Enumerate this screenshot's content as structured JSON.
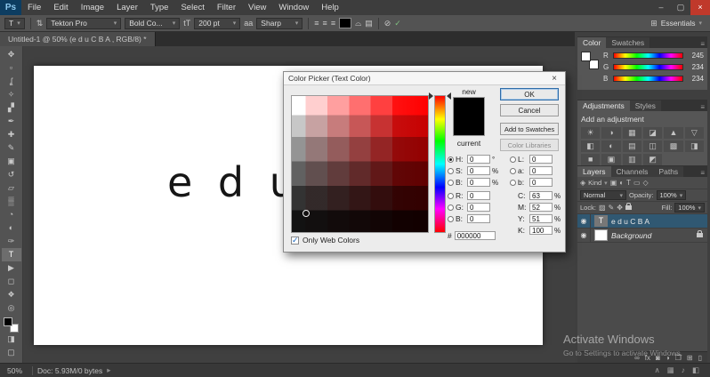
{
  "ui": {
    "caret": "▾",
    "check": "✓",
    "accent_blue": "#0d3d61",
    "selected_layer_blue": "#305872"
  },
  "window": {
    "minimize": "–",
    "maximize": "▢",
    "close": "×"
  },
  "menu": {
    "logo": "Ps",
    "items": [
      "File",
      "Edit",
      "Image",
      "Layer",
      "Type",
      "Select",
      "Filter",
      "View",
      "Window",
      "Help"
    ]
  },
  "options": {
    "tool_preset": "T",
    "orientation_icon": "⇅",
    "font_family": "Tekton Pro",
    "font_style": "Bold Co...",
    "size_icon": "tT",
    "font_size": "200 pt",
    "aa_icon": "aa",
    "anti_alias": "Sharp",
    "align_left_icon": "≡",
    "align_center_icon": "≡",
    "align_right_icon": "≡",
    "text_color": "#000000",
    "warp_icon": "⌓",
    "panels_icon": "▤",
    "cancel_icon": "⊘",
    "commit_icon": "✓",
    "workspace_icon": "⊞",
    "workspace": "Essentials"
  },
  "tab": {
    "title": "Untitled-1 @ 50% (e d u C B A , RGB/8) *"
  },
  "tools": [
    {
      "name": "move",
      "glyph": "✥"
    },
    {
      "name": "marquee",
      "glyph": "▫"
    },
    {
      "name": "lasso",
      "glyph": "ʆ"
    },
    {
      "name": "quick-selection",
      "glyph": "✧"
    },
    {
      "name": "crop",
      "glyph": "▞"
    },
    {
      "name": "eyedropper",
      "glyph": "✒"
    },
    {
      "name": "healing-brush",
      "glyph": "✚"
    },
    {
      "name": "brush",
      "glyph": "✎"
    },
    {
      "name": "clone-stamp",
      "glyph": "▣"
    },
    {
      "name": "history-brush",
      "glyph": "↺"
    },
    {
      "name": "eraser",
      "glyph": "▱"
    },
    {
      "name": "gradient",
      "glyph": "▒"
    },
    {
      "name": "blur",
      "glyph": "◔"
    },
    {
      "name": "dodge",
      "glyph": "◐"
    },
    {
      "name": "pen",
      "glyph": "✑"
    },
    {
      "name": "type",
      "glyph": "T"
    },
    {
      "name": "path-selection",
      "glyph": "▶"
    },
    {
      "name": "shape",
      "glyph": "◻"
    },
    {
      "name": "hand",
      "glyph": "❖"
    },
    {
      "name": "zoom",
      "glyph": "◎"
    },
    {
      "name": "quick-mask",
      "glyph": "◨"
    },
    {
      "name": "screen-mode",
      "glyph": "▢"
    }
  ],
  "canvas": {
    "text": "e d u C B A"
  },
  "dialog": {
    "title": "Color Picker (Text Color)",
    "close": "×",
    "new_label": "new",
    "current_label": "current",
    "picked_color": "#000000",
    "ok": "OK",
    "cancel": "Cancel",
    "add_to_swatches": "Add to Swatches",
    "color_libraries": "Color Libraries",
    "hsb": [
      {
        "label": "H:",
        "value": "0",
        "unit": "°"
      },
      {
        "label": "S:",
        "value": "0",
        "unit": "%"
      },
      {
        "label": "B:",
        "value": "0",
        "unit": "%"
      }
    ],
    "rgb": [
      {
        "label": "R:",
        "value": "0",
        "unit": ""
      },
      {
        "label": "G:",
        "value": "0",
        "unit": ""
      },
      {
        "label": "B:",
        "value": "0",
        "unit": ""
      }
    ],
    "lab": [
      {
        "label": "L:",
        "value": "0",
        "unit": ""
      },
      {
        "label": "a:",
        "value": "0",
        "unit": ""
      },
      {
        "label": "b:",
        "value": "0",
        "unit": ""
      }
    ],
    "cmyk": [
      {
        "label": "C:",
        "value": "63",
        "unit": "%"
      },
      {
        "label": "M:",
        "value": "52",
        "unit": "%"
      },
      {
        "label": "Y:",
        "value": "51",
        "unit": "%"
      },
      {
        "label": "K:",
        "value": "100",
        "unit": "%"
      }
    ],
    "hex_label": "#",
    "hex_value": "000000",
    "only_web_colors": "Only Web Colors"
  },
  "color_panel": {
    "tabs": [
      "Color",
      "Swatches"
    ],
    "menu_icon": "≡",
    "sliders": [
      {
        "label": "R",
        "value": "245"
      },
      {
        "label": "G",
        "value": "234"
      },
      {
        "label": "B",
        "value": "234"
      }
    ]
  },
  "adjustments": {
    "tabs": [
      "Adjustments",
      "Styles"
    ],
    "menu_icon": "≡",
    "title": "Add an adjustment",
    "icons": [
      "☀",
      "◑",
      "▦",
      "◪",
      "▲",
      "▽",
      "◧",
      "◐",
      "▤",
      "◫",
      "▩",
      "◨",
      "■",
      "▣",
      "▥",
      "◩"
    ]
  },
  "layers": {
    "tabs": [
      "Layers",
      "Channels",
      "Paths"
    ],
    "menu_icon": "≡",
    "filter": {
      "search_icon": "◈",
      "kind": "Kind",
      "icons": [
        "▣",
        "◐",
        "T",
        "▭",
        "◇"
      ]
    },
    "blend_mode": "Normal",
    "opacity_label": "Opacity:",
    "opacity": "100%",
    "lock_label": "Lock:",
    "lock_icons": [
      "▨",
      "✎",
      "✥"
    ],
    "fill_label": "Fill:",
    "fill": "100%",
    "eye_icon": "◉",
    "rows": [
      {
        "thumb": "T",
        "name": "e d u C B A"
      },
      {
        "thumb": "",
        "name": "Background"
      }
    ],
    "bottom_icons": [
      "∞",
      "fx",
      "◙",
      "◑",
      "❐",
      "⊞",
      "▯"
    ]
  },
  "status": {
    "zoom": "50%",
    "doc_info": "Doc: 5.93M/0 bytes",
    "expand_arrow": "▸"
  },
  "tray": {
    "icons": [
      "∧",
      "▦",
      "♪",
      "◧"
    ]
  },
  "watermark": {
    "line1": "Activate Windows",
    "line2": "Go to Settings to activate Windows."
  }
}
